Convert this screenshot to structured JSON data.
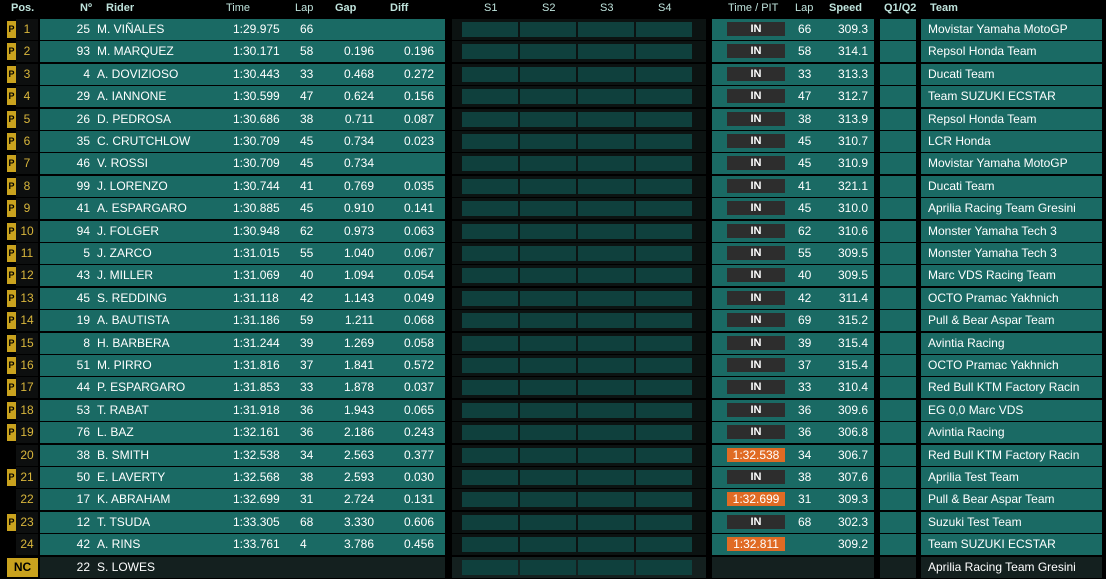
{
  "headers": {
    "pos": "Pos.",
    "no": "Nº",
    "rider": "Rider",
    "time": "Time",
    "lap": "Lap",
    "gap": "Gap",
    "diff": "Diff",
    "s1": "S1",
    "s2": "S2",
    "s3": "S3",
    "s4": "S4",
    "time_pit": "Time / PIT",
    "lap2": "Lap",
    "speed": "Speed",
    "q": "Q1/Q2",
    "team": "Team"
  },
  "rows": [
    {
      "pos": "1",
      "p": "P",
      "num": "25",
      "rider": "M. VIÑALES",
      "time": "1:29.975",
      "lap": "66",
      "gap": "",
      "diff": "",
      "pit": "IN",
      "lap2": "66",
      "speed": "309.3",
      "team": "Movistar Yamaha MotoGP"
    },
    {
      "pos": "2",
      "p": "P",
      "num": "93",
      "rider": "M. MARQUEZ",
      "time": "1:30.171",
      "lap": "58",
      "gap": "0.196",
      "diff": "0.196",
      "pit": "IN",
      "lap2": "58",
      "speed": "314.1",
      "team": "Repsol Honda Team"
    },
    {
      "pos": "3",
      "p": "P",
      "num": "4",
      "rider": "A. DOVIZIOSO",
      "time": "1:30.443",
      "lap": "33",
      "gap": "0.468",
      "diff": "0.272",
      "pit": "IN",
      "lap2": "33",
      "speed": "313.3",
      "team": "Ducati Team"
    },
    {
      "pos": "4",
      "p": "P",
      "num": "29",
      "rider": "A. IANNONE",
      "time": "1:30.599",
      "lap": "47",
      "gap": "0.624",
      "diff": "0.156",
      "pit": "IN",
      "lap2": "47",
      "speed": "312.7",
      "team": "Team SUZUKI ECSTAR"
    },
    {
      "pos": "5",
      "p": "P",
      "num": "26",
      "rider": "D. PEDROSA",
      "time": "1:30.686",
      "lap": "38",
      "gap": "0.711",
      "diff": "0.087",
      "pit": "IN",
      "lap2": "38",
      "speed": "313.9",
      "team": "Repsol Honda Team"
    },
    {
      "pos": "6",
      "p": "P",
      "num": "35",
      "rider": "C. CRUTCHLOW",
      "time": "1:30.709",
      "lap": "45",
      "gap": "0.734",
      "diff": "0.023",
      "pit": "IN",
      "lap2": "45",
      "speed": "310.7",
      "team": "LCR Honda"
    },
    {
      "pos": "7",
      "p": "P",
      "num": "46",
      "rider": "V. ROSSI",
      "time": "1:30.709",
      "lap": "45",
      "gap": "0.734",
      "diff": "",
      "pit": "IN",
      "lap2": "45",
      "speed": "310.9",
      "team": "Movistar Yamaha MotoGP"
    },
    {
      "pos": "8",
      "p": "P",
      "num": "99",
      "rider": "J. LORENZO",
      "time": "1:30.744",
      "lap": "41",
      "gap": "0.769",
      "diff": "0.035",
      "pit": "IN",
      "lap2": "41",
      "speed": "321.1",
      "team": "Ducati Team"
    },
    {
      "pos": "9",
      "p": "P",
      "num": "41",
      "rider": "A. ESPARGARO",
      "time": "1:30.885",
      "lap": "45",
      "gap": "0.910",
      "diff": "0.141",
      "pit": "IN",
      "lap2": "45",
      "speed": "310.0",
      "team": "Aprilia Racing Team Gresini"
    },
    {
      "pos": "10",
      "p": "P",
      "num": "94",
      "rider": "J. FOLGER",
      "time": "1:30.948",
      "lap": "62",
      "gap": "0.973",
      "diff": "0.063",
      "pit": "IN",
      "lap2": "62",
      "speed": "310.6",
      "team": "Monster Yamaha Tech 3"
    },
    {
      "pos": "11",
      "p": "P",
      "num": "5",
      "rider": "J. ZARCO",
      "time": "1:31.015",
      "lap": "55",
      "gap": "1.040",
      "diff": "0.067",
      "pit": "IN",
      "lap2": "55",
      "speed": "309.5",
      "team": "Monster Yamaha Tech 3"
    },
    {
      "pos": "12",
      "p": "P",
      "num": "43",
      "rider": "J. MILLER",
      "time": "1:31.069",
      "lap": "40",
      "gap": "1.094",
      "diff": "0.054",
      "pit": "IN",
      "lap2": "40",
      "speed": "309.5",
      "team": "Marc VDS Racing Team"
    },
    {
      "pos": "13",
      "p": "P",
      "num": "45",
      "rider": "S. REDDING",
      "time": "1:31.118",
      "lap": "42",
      "gap": "1.143",
      "diff": "0.049",
      "pit": "IN",
      "lap2": "42",
      "speed": "311.4",
      "team": "OCTO Pramac Yakhnich"
    },
    {
      "pos": "14",
      "p": "P",
      "num": "19",
      "rider": "A. BAUTISTA",
      "time": "1:31.186",
      "lap": "59",
      "gap": "1.211",
      "diff": "0.068",
      "pit": "IN",
      "lap2": "69",
      "speed": "315.2",
      "team": "Pull & Bear Aspar Team"
    },
    {
      "pos": "15",
      "p": "P",
      "num": "8",
      "rider": "H. BARBERA",
      "time": "1:31.244",
      "lap": "39",
      "gap": "1.269",
      "diff": "0.058",
      "pit": "IN",
      "lap2": "39",
      "speed": "315.4",
      "team": "Avintia Racing"
    },
    {
      "pos": "16",
      "p": "P",
      "num": "51",
      "rider": "M. PIRRO",
      "time": "1:31.816",
      "lap": "37",
      "gap": "1.841",
      "diff": "0.572",
      "pit": "IN",
      "lap2": "37",
      "speed": "315.4",
      "team": "OCTO Pramac Yakhnich"
    },
    {
      "pos": "17",
      "p": "P",
      "num": "44",
      "rider": "P. ESPARGARO",
      "time": "1:31.853",
      "lap": "33",
      "gap": "1.878",
      "diff": "0.037",
      "pit": "IN",
      "lap2": "33",
      "speed": "310.4",
      "team": "Red Bull KTM Factory Racin"
    },
    {
      "pos": "18",
      "p": "P",
      "num": "53",
      "rider": "T. RABAT",
      "time": "1:31.918",
      "lap": "36",
      "gap": "1.943",
      "diff": "0.065",
      "pit": "IN",
      "lap2": "36",
      "speed": "309.6",
      "team": "EG 0,0 Marc VDS"
    },
    {
      "pos": "19",
      "p": "P",
      "num": "76",
      "rider": "L. BAZ",
      "time": "1:32.161",
      "lap": "36",
      "gap": "2.186",
      "diff": "0.243",
      "pit": "IN",
      "lap2": "36",
      "speed": "306.8",
      "team": "Avintia Racing"
    },
    {
      "pos": "20",
      "p": "",
      "num": "38",
      "rider": "B. SMITH",
      "time": "1:32.538",
      "lap": "34",
      "gap": "2.563",
      "diff": "0.377",
      "pit": "1:32.538",
      "lap2": "34",
      "speed": "306.7",
      "team": "Red Bull KTM Factory Racin"
    },
    {
      "pos": "21",
      "p": "P",
      "num": "50",
      "rider": "E. LAVERTY",
      "time": "1:32.568",
      "lap": "38",
      "gap": "2.593",
      "diff": "0.030",
      "pit": "IN",
      "lap2": "38",
      "speed": "307.6",
      "team": "Aprilia Test Team"
    },
    {
      "pos": "22",
      "p": "",
      "num": "17",
      "rider": "K. ABRAHAM",
      "time": "1:32.699",
      "lap": "31",
      "gap": "2.724",
      "diff": "0.131",
      "pit": "1:32.699",
      "lap2": "31",
      "speed": "309.3",
      "team": "Pull & Bear Aspar Team"
    },
    {
      "pos": "23",
      "p": "P",
      "num": "12",
      "rider": "T. TSUDA",
      "time": "1:33.305",
      "lap": "68",
      "gap": "3.330",
      "diff": "0.606",
      "pit": "IN",
      "lap2": "68",
      "speed": "302.3",
      "team": "Suzuki Test Team"
    },
    {
      "pos": "24",
      "p": "",
      "num": "42",
      "rider": "A. RINS",
      "time": "1:33.761",
      "lap": "4",
      "gap": "3.786",
      "diff": "0.456",
      "pit": "1:32.811",
      "lap2": "",
      "speed": "309.2",
      "team": "Team SUZUKI ECSTAR"
    },
    {
      "pos": "NC",
      "p": "",
      "num": "22",
      "rider": "S. LOWES",
      "time": "",
      "lap": "",
      "gap": "",
      "diff": "",
      "pit": "",
      "lap2": "",
      "speed": "",
      "team": "Aprilia Racing Team Gresini"
    }
  ]
}
